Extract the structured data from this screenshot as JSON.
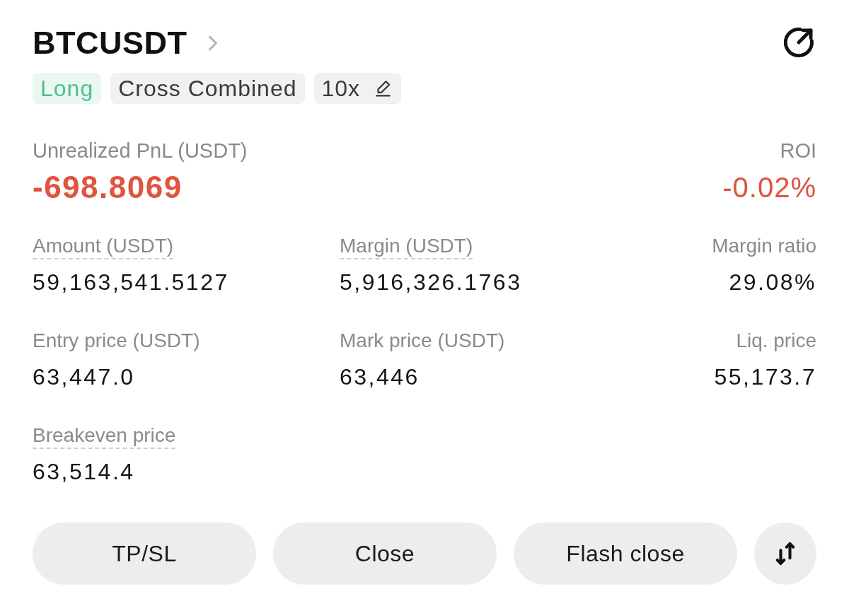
{
  "header": {
    "symbol": "BTCUSDT"
  },
  "tags": [
    {
      "kind": "side",
      "label": "Long"
    },
    {
      "kind": "mode",
      "label": "Cross Combined"
    },
    {
      "kind": "leverage",
      "label": "10x"
    }
  ],
  "pnl": {
    "label": "Unrealized PnL (USDT)",
    "value": "-698.8069",
    "negative": true
  },
  "roi": {
    "label": "ROI",
    "value": "-0.02%",
    "negative": true
  },
  "fields": [
    {
      "label": "Amount (USDT)",
      "value": "59,163,541.5127",
      "underlined": true
    },
    {
      "label": "Margin (USDT)",
      "value": "5,916,326.1763",
      "underlined": true
    },
    {
      "label": "Margin ratio",
      "value": "29.08%",
      "underlined": false
    },
    {
      "label": "Entry price (USDT)",
      "value": "63,447.0",
      "underlined": false
    },
    {
      "label": "Mark price (USDT)",
      "value": "63,446",
      "underlined": false
    },
    {
      "label": "Liq. price",
      "value": "55,173.7",
      "underlined": false
    },
    {
      "label": "Breakeven price",
      "value": "63,514.4",
      "underlined": true
    }
  ],
  "buttons": [
    {
      "label": "TP/SL"
    },
    {
      "label": "Close"
    },
    {
      "label": "Flash close"
    }
  ]
}
